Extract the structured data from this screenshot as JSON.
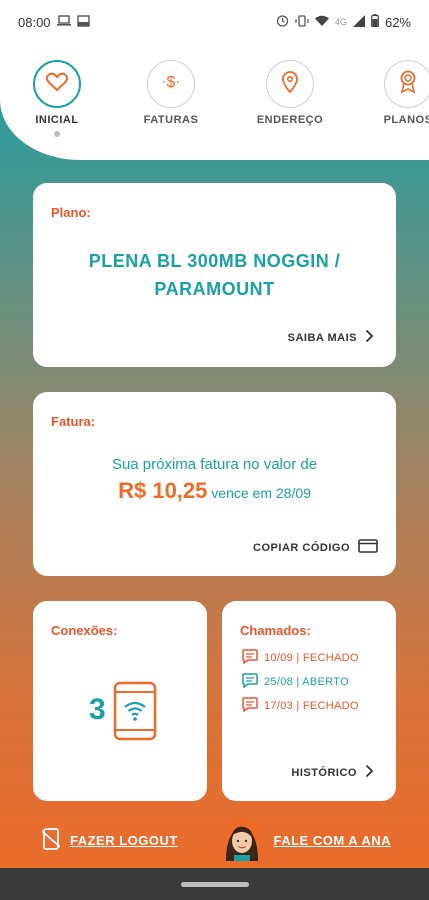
{
  "status_bar": {
    "time": "08:00",
    "network": "4G",
    "battery": "62%"
  },
  "nav": {
    "items": [
      {
        "label": "INICIAL",
        "icon": "heart-icon",
        "active": true
      },
      {
        "label": "FATURAS",
        "icon": "dollar-icon",
        "active": false
      },
      {
        "label": "ENDEREÇO",
        "icon": "location-pin-icon",
        "active": false
      },
      {
        "label": "PLANOS",
        "icon": "award-icon",
        "active": false
      }
    ]
  },
  "plan_card": {
    "label": "Plano:",
    "plan_name": "PLENA BL 300MB NOGGIN / PARAMOUNT",
    "link": "SAIBA MAIS"
  },
  "invoice_card": {
    "label": "Fatura:",
    "line1": "Sua próxima fatura no valor de",
    "amount": "R$ 10,25",
    "due_text": "vence em 28/09",
    "link": "COPIAR CÓDIGO"
  },
  "connections_card": {
    "label": "Conexões:",
    "count": "3"
  },
  "tickets_card": {
    "label": "Chamados:",
    "items": [
      {
        "text": "10/09 | FECHADO",
        "status": "closed"
      },
      {
        "text": "25/08 | ABERTO",
        "status": "open"
      },
      {
        "text": "17/03 | FECHADO",
        "status": "closed"
      }
    ],
    "link": "HISTÓRICO"
  },
  "bottom": {
    "logout": "FAZER LOGOUT",
    "chat": "FALE COM A ANA"
  },
  "colors": {
    "teal": "#1aa0a6",
    "orange": "#ee6a28",
    "label_red": "#e8552a"
  }
}
